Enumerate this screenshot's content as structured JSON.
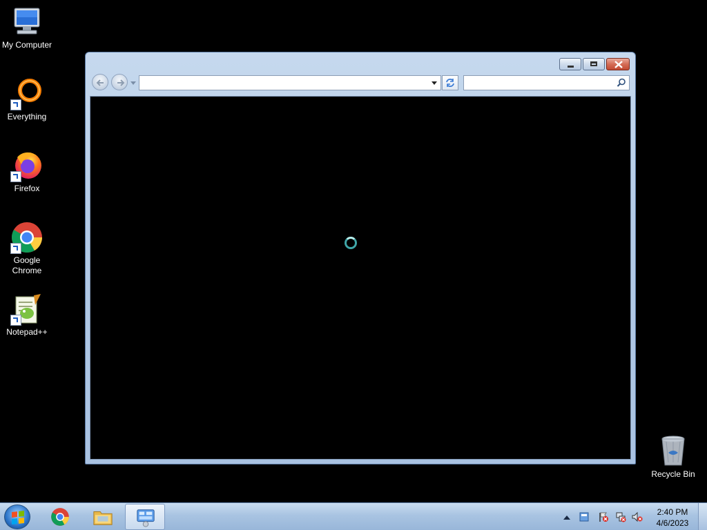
{
  "desktop": {
    "icons": [
      {
        "label": "My Computer",
        "icon": "computer-icon"
      },
      {
        "label": "Everything",
        "icon": "everything-search-icon"
      },
      {
        "label": "Firefox",
        "icon": "firefox-icon"
      },
      {
        "label": "Google Chrome",
        "icon": "chrome-icon"
      },
      {
        "label": "Notepad++",
        "icon": "notepadpp-icon"
      },
      {
        "label": "Recycle Bin",
        "icon": "recycle-bin-icon"
      }
    ]
  },
  "window": {
    "address_value": "",
    "search_value": "",
    "content_state": "loading"
  },
  "taskbar": {
    "pinned": [
      {
        "app": "Google Chrome",
        "icon": "chrome-icon"
      },
      {
        "app": "Windows Explorer",
        "icon": "folder-icon"
      },
      {
        "app": "Control Panel",
        "icon": "control-panel-icon",
        "active": true
      }
    ],
    "clock_time": "2:40 PM",
    "clock_date": "4/6/2023"
  },
  "colors": {
    "desktop_bg": "#000000",
    "taskbar": "#a9c4e2",
    "window_frame": "#b4cbe6",
    "spinner": "#3fa6a8"
  }
}
